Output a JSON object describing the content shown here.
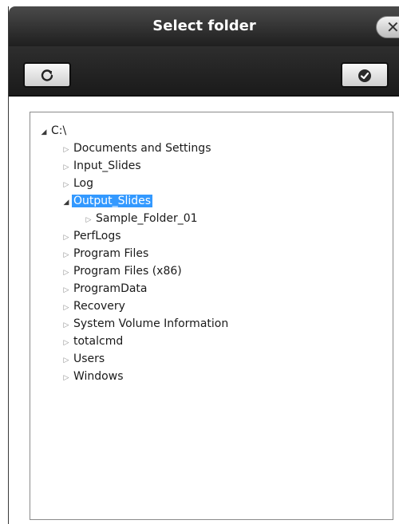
{
  "window": {
    "title": "Select folder",
    "close_icon": "close-icon"
  },
  "toolbar": {
    "refresh_icon": "refresh-icon",
    "confirm_icon": "checkmark-icon"
  },
  "tree": {
    "root": {
      "label": "C:\\",
      "expanded": true
    },
    "items": [
      {
        "label": "Documents and Settings",
        "expanded": false,
        "selected": false
      },
      {
        "label": "Input_Slides",
        "expanded": false,
        "selected": false
      },
      {
        "label": "Log",
        "expanded": false,
        "selected": false
      },
      {
        "label": "Output_Slides",
        "expanded": true,
        "selected": true,
        "children": [
          {
            "label": "Sample_Folder_01",
            "expanded": false
          }
        ]
      },
      {
        "label": "PerfLogs",
        "expanded": false,
        "selected": false
      },
      {
        "label": "Program Files",
        "expanded": false,
        "selected": false
      },
      {
        "label": "Program Files (x86)",
        "expanded": false,
        "selected": false
      },
      {
        "label": "ProgramData",
        "expanded": false,
        "selected": false
      },
      {
        "label": "Recovery",
        "expanded": false,
        "selected": false
      },
      {
        "label": "System Volume Information",
        "expanded": false,
        "selected": false
      },
      {
        "label": "totalcmd",
        "expanded": false,
        "selected": false
      },
      {
        "label": "Users",
        "expanded": false,
        "selected": false
      },
      {
        "label": "Windows",
        "expanded": false,
        "selected": false
      }
    ]
  },
  "colors": {
    "selection": "#3399ff",
    "titlebar": "#1f1f1f"
  }
}
